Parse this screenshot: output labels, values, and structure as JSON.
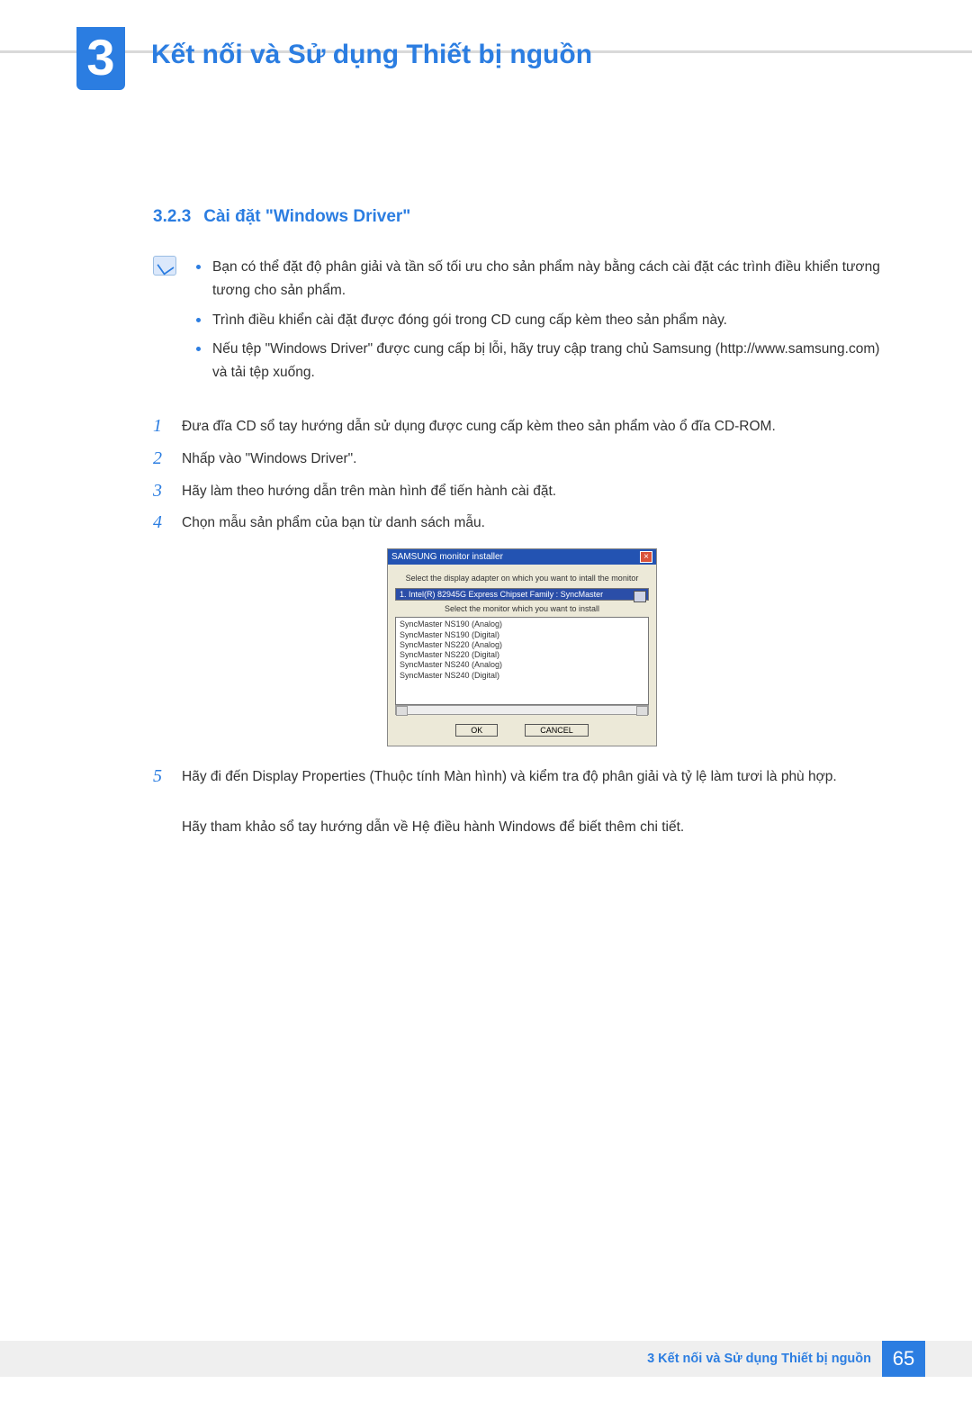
{
  "chapter": {
    "number": "3",
    "title": "Kết nối và Sử dụng Thiết bị nguồn"
  },
  "subsection": {
    "number": "3.2.3",
    "title": "Cài đặt \"Windows Driver\""
  },
  "notes": [
    "Bạn có thể đặt độ phân giải và tần số tối ưu cho sản phẩm này bằng cách cài đặt các trình điều khiển tương tương cho sản phẩm.",
    "Trình điều khiển cài đặt được đóng gói trong CD cung cấp kèm theo sản phẩm này.",
    "Nếu tệp \"Windows Driver\" được cung cấp bị lỗi, hãy truy cập trang chủ Samsung (http://www.samsung.com) và tải tệp xuống."
  ],
  "steps": {
    "1": "Đưa đĩa CD sổ tay hướng dẫn sử dụng được cung cấp kèm theo sản phẩm vào ổ đĩa CD-ROM.",
    "2": "Nhấp vào \"Windows Driver\".",
    "3": "Hãy làm theo hướng dẫn trên màn hình để tiến hành cài đặt.",
    "4": "Chọn mẫu sản phẩm của bạn từ danh sách mẫu.",
    "5a": "Hãy đi đến Display Properties (Thuộc tính Màn hình) và kiểm tra độ phân giải và tỷ lệ làm tươi là phù hợp.",
    "5b": "Hãy tham khảo sổ tay hướng dẫn về Hệ điều hành Windows để biết thêm chi tiết."
  },
  "installer": {
    "title": "SAMSUNG monitor installer",
    "close": "×",
    "label_adapter": "Select the display adapter on which you want to intall the monitor",
    "adapter_value": "1. Intel(R) 82945G Express Chipset Family : SyncMaster",
    "label_monitor": "Select the monitor which you want to install",
    "monitors": [
      "SyncMaster NS190 (Analog)",
      "SyncMaster NS190 (Digital)",
      "SyncMaster NS220 (Analog)",
      "SyncMaster NS220 (Digital)",
      "SyncMaster NS240 (Analog)",
      "SyncMaster NS240 (Digital)"
    ],
    "ok": "OK",
    "cancel": "CANCEL"
  },
  "footer": {
    "chapter_ref": "3 Kết nối và Sử dụng Thiết bị nguồn",
    "page": "65"
  }
}
